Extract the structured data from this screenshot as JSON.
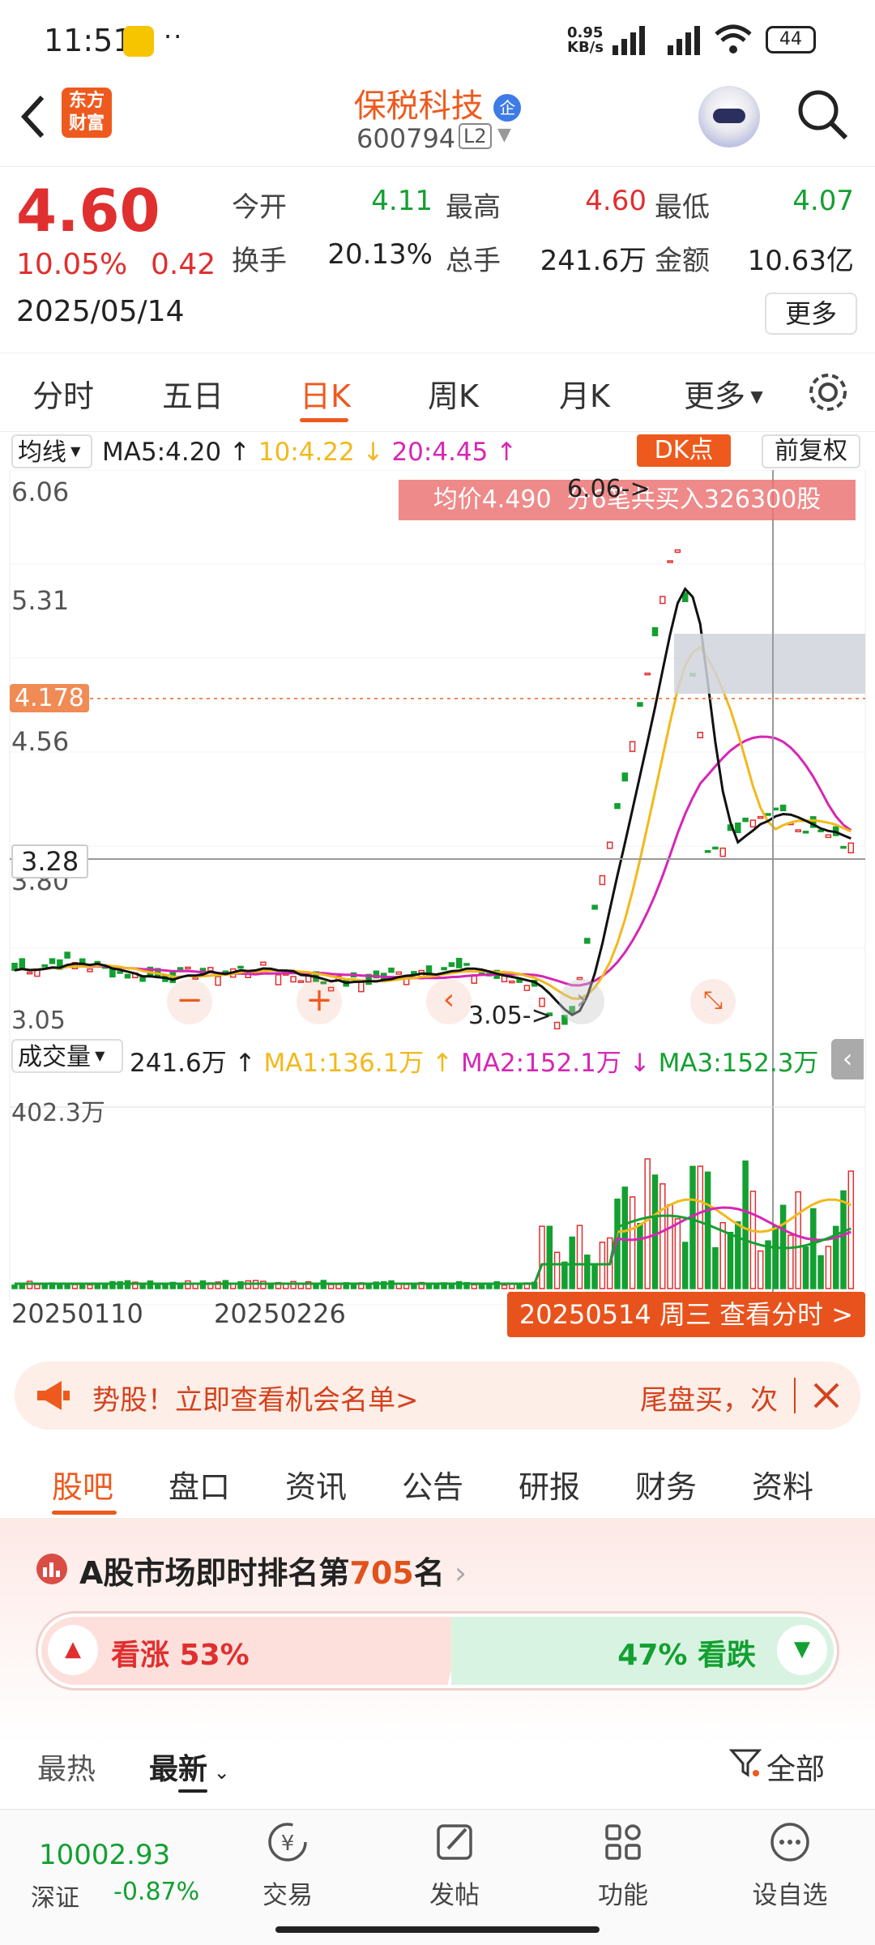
{
  "status_bar": {
    "time": "11:51",
    "net_speed_top": "0.95",
    "net_speed_unit": "KB/s",
    "battery": "44"
  },
  "header": {
    "logo_line1": "东方",
    "logo_line2": "财富",
    "stock_name": "保税科技",
    "badge": "企",
    "stock_code": "600794",
    "level_badge": "L2"
  },
  "quote": {
    "price": "4.60",
    "change_pct": "10.05%",
    "change_abs": "0.42",
    "date": "2025/05/14",
    "fields": [
      {
        "label": "今开",
        "value": "4.11",
        "color": "#13a031"
      },
      {
        "label": "最高",
        "value": "4.60",
        "color": "#e02f2f"
      },
      {
        "label": "最低",
        "value": "4.07",
        "color": "#13a031"
      },
      {
        "label": "换手",
        "value": "20.13%",
        "color": "#222"
      },
      {
        "label": "总手",
        "value": "241.6万",
        "color": "#222"
      },
      {
        "label": "金额",
        "value": "10.63亿",
        "color": "#222"
      }
    ],
    "more_button": "更多"
  },
  "period_tabs": [
    "分时",
    "五日",
    "日K",
    "周K",
    "月K",
    "更多"
  ],
  "active_period": "日K",
  "chart": {
    "ma_selector": "均线",
    "ma5": "MA5:4.20",
    "ma10": "10:4.22",
    "ma20": "20:4.45",
    "dk_button": "DK点",
    "adjust_button": "前复权",
    "y_labels": [
      "6.06",
      "5.31",
      "4.56",
      "3.80",
      "3.05"
    ],
    "current_price_tag": "4.178",
    "cursor_price_tag": "3.28",
    "tooltip": "均价4.490  分6笔共买入326300股",
    "high_annot": "6.06->",
    "low_annot": "3.05->",
    "vol_selector": "成交量",
    "vol_value": "241.6万",
    "vol_ma1": "MA1:136.1万",
    "vol_ma2": "MA2:152.1万",
    "vol_ma3": "MA3:152.3万",
    "vol_max": "402.3万",
    "date_left": "20250110",
    "date_mid": "20250226",
    "view_timeshare": "20250514 周三 查看分时 >",
    "colors": {
      "up": "#e02f2f",
      "down": "#13a031",
      "ma5": "#111111",
      "ma10": "#f2b91c",
      "ma20": "#d726b5"
    }
  },
  "banner": {
    "text": "势股！立即查看机会名单>",
    "text2": "尾盘买，次"
  },
  "info_tabs": [
    "股吧",
    "盘口",
    "资讯",
    "公告",
    "研报",
    "财务",
    "资料"
  ],
  "active_info_tab": "股吧",
  "rank": {
    "prefix": "A股市场即时排名第",
    "rank": "705",
    "suffix": "名",
    "bull": "看涨 53%",
    "bear": "47% 看跌",
    "bull_pct": 53
  },
  "sort": {
    "hot": "最热",
    "latest": "最新",
    "filter": "全部"
  },
  "bottom_nav": {
    "index_value": "10002.93",
    "index_name": "深证",
    "index_change": "-0.87%",
    "items": [
      "交易",
      "发帖",
      "功能",
      "设自选"
    ]
  }
}
